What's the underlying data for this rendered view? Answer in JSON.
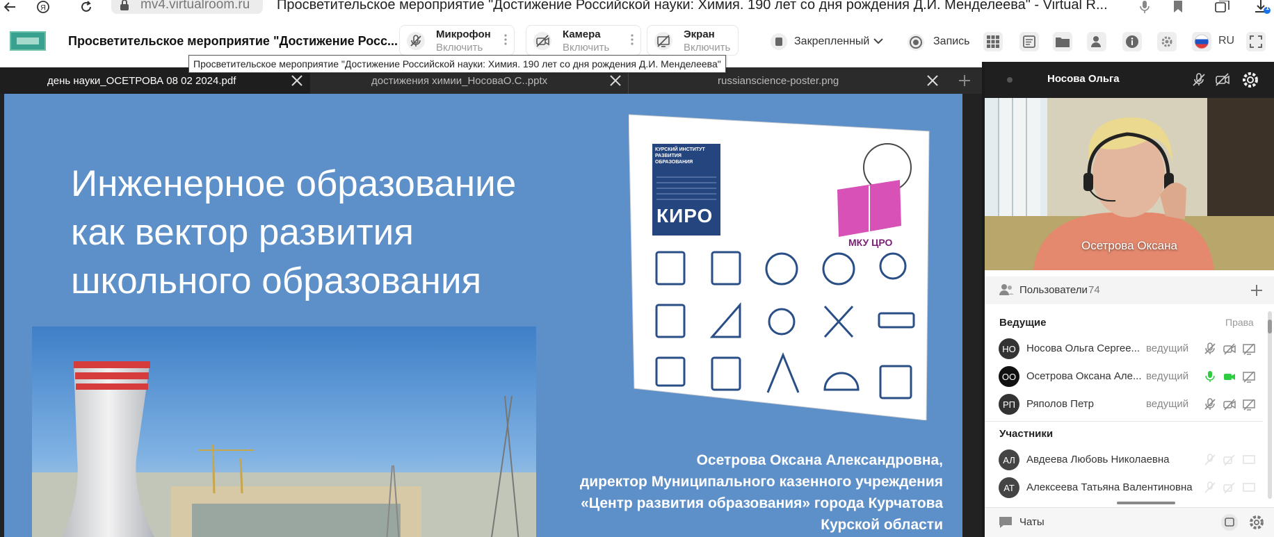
{
  "browser": {
    "url": "mv4.virtualroom.ru",
    "page_title": "Просветительское мероприятие \"Достижение Российской науки: Химия. 190 лет со дня рождения Д.И. Менделеева\" - Virtual R...",
    "download_badge": "1"
  },
  "header": {
    "event_title": "Просветительское мероприятие \"Достижение Росс...",
    "controls": [
      {
        "label": "Микрофон",
        "sub": "Включить",
        "icon": "mic-off-icon"
      },
      {
        "label": "Камера",
        "sub": "Включить",
        "icon": "camera-off-icon"
      },
      {
        "label": "Экран",
        "sub": "Включить",
        "icon": "screen-share-off-icon"
      }
    ],
    "layout_label": "Закрепленный",
    "record_label": "Запись",
    "language": "RU"
  },
  "tooltip": "Просветительское мероприятие \"Достижение Российской науки: Химия. 190 лет со дня рождения Д.И. Менделеева\"",
  "tabs": [
    {
      "label": "день науки_ОСЕТРОВА 08 02 2024.pdf",
      "active": true
    },
    {
      "label": "достижения химии_НосоваО.С..pptx",
      "active": false
    },
    {
      "label": "russianscience-poster.png",
      "active": false
    }
  ],
  "slide": {
    "title": "Инженерное образование\nкак вектор развития\nшкольного образования",
    "poster_org1": "КУРСКИЙ ИНСТИТУТ РАЗВИТИЯ ОБРАЗОВАНИЯ",
    "poster_logo1": "КИРО",
    "poster_logo2": "МКУ ЦРО",
    "presenter_lines": [
      "Осетрова Оксана Александровна,",
      "директор Муниципального казенного учреждения",
      "«Центр развития образования» города Курчатова",
      "Курской области"
    ]
  },
  "right_panel": {
    "speaker_name": "Носова Ольга",
    "video_name": "Осетрова Оксана",
    "users_label": "Пользователи",
    "users_count": "74",
    "hosts_label": "Ведущие",
    "rights_label": "Права",
    "hosts": [
      {
        "initials": "НО",
        "name": "Носова Ольга Сергее...",
        "role": "ведущий",
        "mic": "off",
        "cam": "off"
      },
      {
        "initials": "ОО",
        "name": "Осетрова Оксана Але...",
        "role": "ведущий",
        "mic": "on",
        "cam": "on"
      },
      {
        "initials": "РП",
        "name": "Ряполов Петр",
        "role": "ведущий",
        "mic": "off",
        "cam": "off"
      }
    ],
    "participants_label": "Участники",
    "participants": [
      {
        "initials": "АЛ",
        "name": "Авдеева Любовь Николаевна"
      },
      {
        "initials": "АТ",
        "name": "Алексеева Татьяна Валентиновна"
      }
    ],
    "chats_label": "Чаты"
  },
  "colors": {
    "slide_bg": "#5d8fc9",
    "dark_bar": "#2b2b2b",
    "mic_on": "#2ecc40"
  }
}
